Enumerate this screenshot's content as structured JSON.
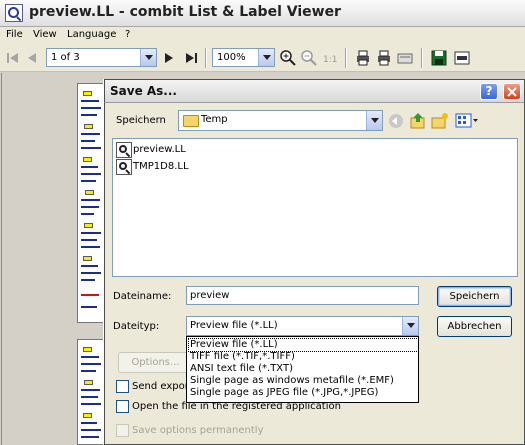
{
  "window": {
    "title": "preview.LL - combit List & Label Viewer"
  },
  "menu": [
    "File",
    "View",
    "Language",
    "?"
  ],
  "toolbar": {
    "page_combo": "1 of 3",
    "zoom_combo": "100%"
  },
  "dialog": {
    "title": "Save As...",
    "save_in_label": "Speichern",
    "save_in_value": "Temp",
    "files": [
      "preview.LL",
      "TMP1D8.LL"
    ],
    "filename_label": "Dateiname:",
    "filename_value": "preview",
    "filetype_label": "Dateityp:",
    "filetype_value": "Preview file (*.LL)",
    "save_button": "Speichern",
    "cancel_button": "Abbrechen",
    "options_button": "Options...",
    "filetype_options": [
      "Preview file (*.LL)",
      "TIFF file (*.TIF,*.TIFF)",
      "ANSI text file (*.TXT)",
      "Single page as windows metafile (*.EMF)",
      "Single page as JPEG file (*.JPG,*.JPEG)"
    ],
    "send_export_label": "Send expor",
    "open_file_label": "Open the file in the registered application",
    "save_options_label": "Save options permanently"
  }
}
